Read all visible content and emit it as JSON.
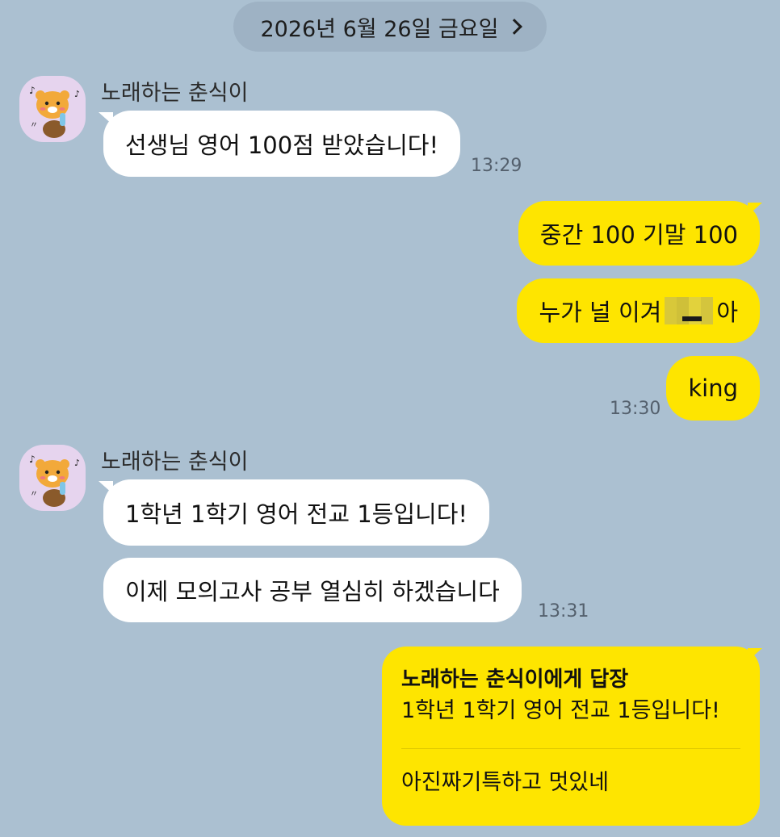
{
  "date_header": "2026년 6월 26일 금요일",
  "colors": {
    "background": "#abc0d1",
    "my_bubble": "#fee500",
    "their_bubble": "#ffffff"
  },
  "groups": [
    {
      "sender": "노래하는 춘식이",
      "messages": [
        "선생님 영어 100점 받았습니다!"
      ],
      "time": "13:29"
    },
    {
      "sender": "노래하는 춘식이",
      "messages": [
        "1학년 1학기 영어 전교 1등입니다!",
        "이제 모의고사 공부 열심히 하겠습니다"
      ],
      "time": "13:31"
    }
  ],
  "mine": {
    "messages": [
      "중간 100 기말 100",
      "누가 널 이겨",
      "아",
      "king"
    ],
    "time": "13:30"
  },
  "reply": {
    "title": "노래하는 춘식이에게 답장",
    "quoted": "1학년 1학기 영어 전교 1등입니다!",
    "text": "아진짜기특하고 멋있네"
  }
}
